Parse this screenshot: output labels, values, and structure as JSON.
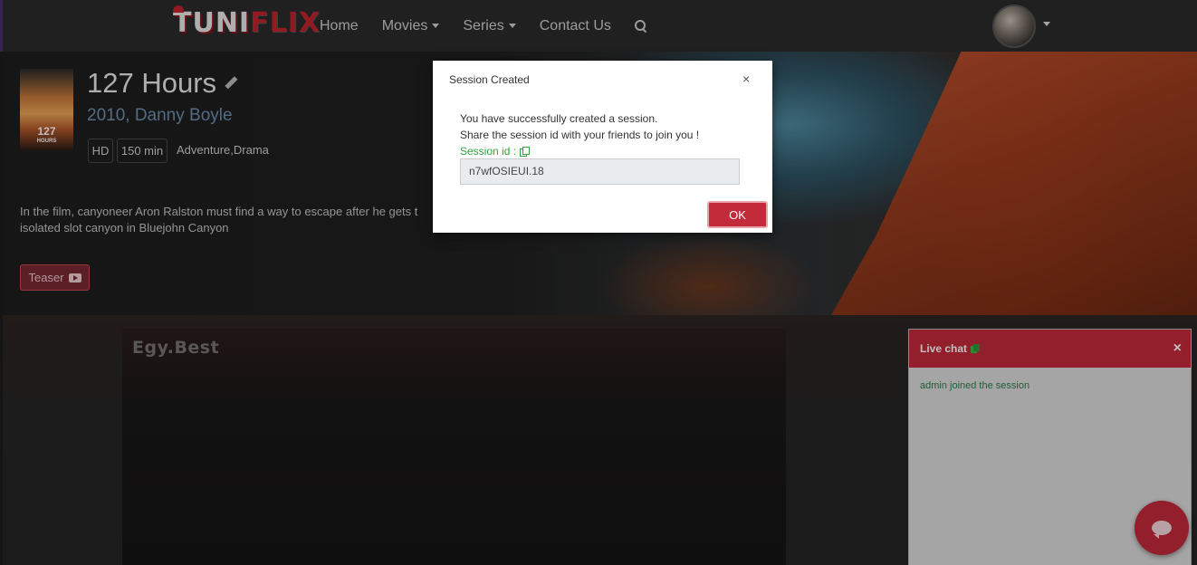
{
  "nav": {
    "logo_part1": "TUNI",
    "logo_part2": "FLIX",
    "links": [
      "Home",
      "Movies",
      "Series",
      "Contact Us"
    ]
  },
  "movie": {
    "poster_text": "127",
    "poster_small": "HOURS",
    "title": "127 Hours",
    "subtitle": "2010, Danny Boyle",
    "quality": "HD",
    "duration": "150 min",
    "genres": "Adventure,Drama",
    "synopsis_line1": "In the film, canyoneer Aron Ralston must find a way to escape after he gets t",
    "synopsis_line2": "isolated slot canyon in Bluejohn Canyon",
    "teaser_label": "Teaser"
  },
  "player": {
    "brand": "Egy.Best"
  },
  "chat": {
    "title": "Live chat",
    "close": "×",
    "message": "admin joined the session"
  },
  "modal": {
    "title": "Session Created",
    "close": "×",
    "line1": "You have successfully created a session.",
    "line2": "Share the session id with your friends to join you !",
    "session_label": "Session id :",
    "session_id": "n7wfOSIEUI.18",
    "ok_label": "OK"
  },
  "colors": {
    "accent": "#c32a3a",
    "success": "#2fa43d"
  }
}
